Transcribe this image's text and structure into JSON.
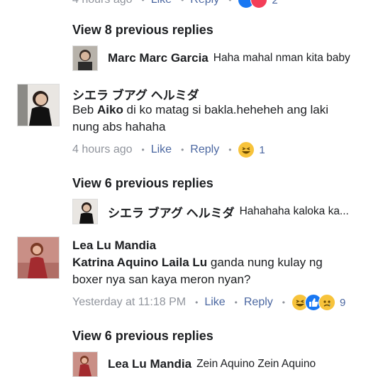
{
  "top_partial": {
    "time": "4 hours ago",
    "like": "Like",
    "reply": "Reply",
    "count": "2"
  },
  "thread1": {
    "view_replies": "View 8 previous replies",
    "reply_author": "Marc Marc Garcia",
    "reply_text": "Haha mahal nman kita baby"
  },
  "comment1": {
    "author": "シエラ ブアグ ヘルミダ",
    "text_prefix": "Beb ",
    "mention": "Aiko",
    "text_line1_rest": " di ko matag si bakla.heheheh ang laki",
    "text_line2": "nung abs hahaha",
    "time": "4 hours ago",
    "like": "Like",
    "reply": "Reply",
    "reaction_count": "1",
    "reactions": [
      "haha"
    ]
  },
  "thread2": {
    "view_replies": "View 6 previous replies",
    "reply_author": "シエラ ブアグ ヘルミダ",
    "reply_text": "Hahahaha kaloka ka..."
  },
  "comment2": {
    "author": "Lea Lu Mandia",
    "mention": "Katrina Aquino Laila Lu",
    "text_line1_rest": " ganda nung kulay ng",
    "text_line2": "boxer nya san kaya meron nyan?",
    "time": "Yesterday at 11:18 PM",
    "like": "Like",
    "reply": "Reply",
    "reaction_count": "9",
    "reactions": [
      "haha",
      "like",
      "sad"
    ]
  },
  "thread3": {
    "view_replies": "View 6 previous replies",
    "reply_author": "Lea Lu Mandia",
    "reply_text": "Zein Aquino Zein Aquino"
  },
  "colors": {
    "link": "#4b67a1",
    "meta": "#90949c",
    "like_blue": "#1877f2",
    "haha_yellow": "#f7c33b",
    "love_red": "#f33e58"
  }
}
